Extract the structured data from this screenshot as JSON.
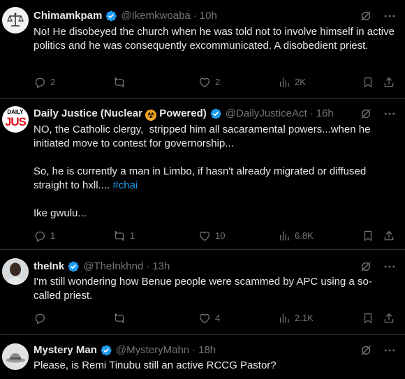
{
  "colors": {
    "background": "#000000",
    "text": "#e7e9ea",
    "muted": "#71767b",
    "accent": "#1d9bf0",
    "divider": "#2f3336",
    "verified": "#1d9bf0"
  },
  "tweets": [
    {
      "name": "Chimamkpam",
      "handle": "@Ikemkwoaba",
      "time": "10h",
      "text": "No! He disobeyed the church when he was told not to involve himself in active politics and he was consequently excommunicated. A disobedient priest.",
      "replies": "2",
      "retweets": "",
      "likes": "2",
      "views": "2K"
    },
    {
      "name_prefix": "Daily Justice (Nuclear ",
      "name_emoji": "☢",
      "name_suffix": " Powered)",
      "handle": "@DailyJusticeAct",
      "time": "16h",
      "avatar_text_top": "DAILY",
      "avatar_text_bottom": "JUS",
      "text_1": "NO, the Catholic clergy,  stripped him all sacaramental powers...when he initiated move to contest for governorship...",
      "text_2": "So, he is currently a man in Limbo, if hasn't already migrated or diffused straight to hxll.... ",
      "hashtag": "#chai",
      "text_3": "Ike gwulu...",
      "replies": "1",
      "retweets": "1",
      "likes": "10",
      "views": "6.8K"
    },
    {
      "name": "theInk",
      "handle": "@TheInkhnd",
      "time": "13h",
      "text": "I'm still wondering how Benue people were scammed by APC using a so-called priest.",
      "replies": "",
      "retweets": "",
      "likes": "4",
      "views": "2.1K"
    },
    {
      "name": "Mystery Man",
      "handle": "@MysteryMahn",
      "time": "18h",
      "text": "Please, is Remi Tinubu still an active RCCG Pastor?"
    }
  ],
  "icons": {
    "verified": "verified-badge-icon",
    "grok": "grok-icon",
    "more": "more-icon",
    "reply": "reply-icon",
    "retweet": "retweet-icon",
    "like": "heart-icon",
    "views": "views-icon",
    "bookmark": "bookmark-icon",
    "share": "share-icon"
  }
}
